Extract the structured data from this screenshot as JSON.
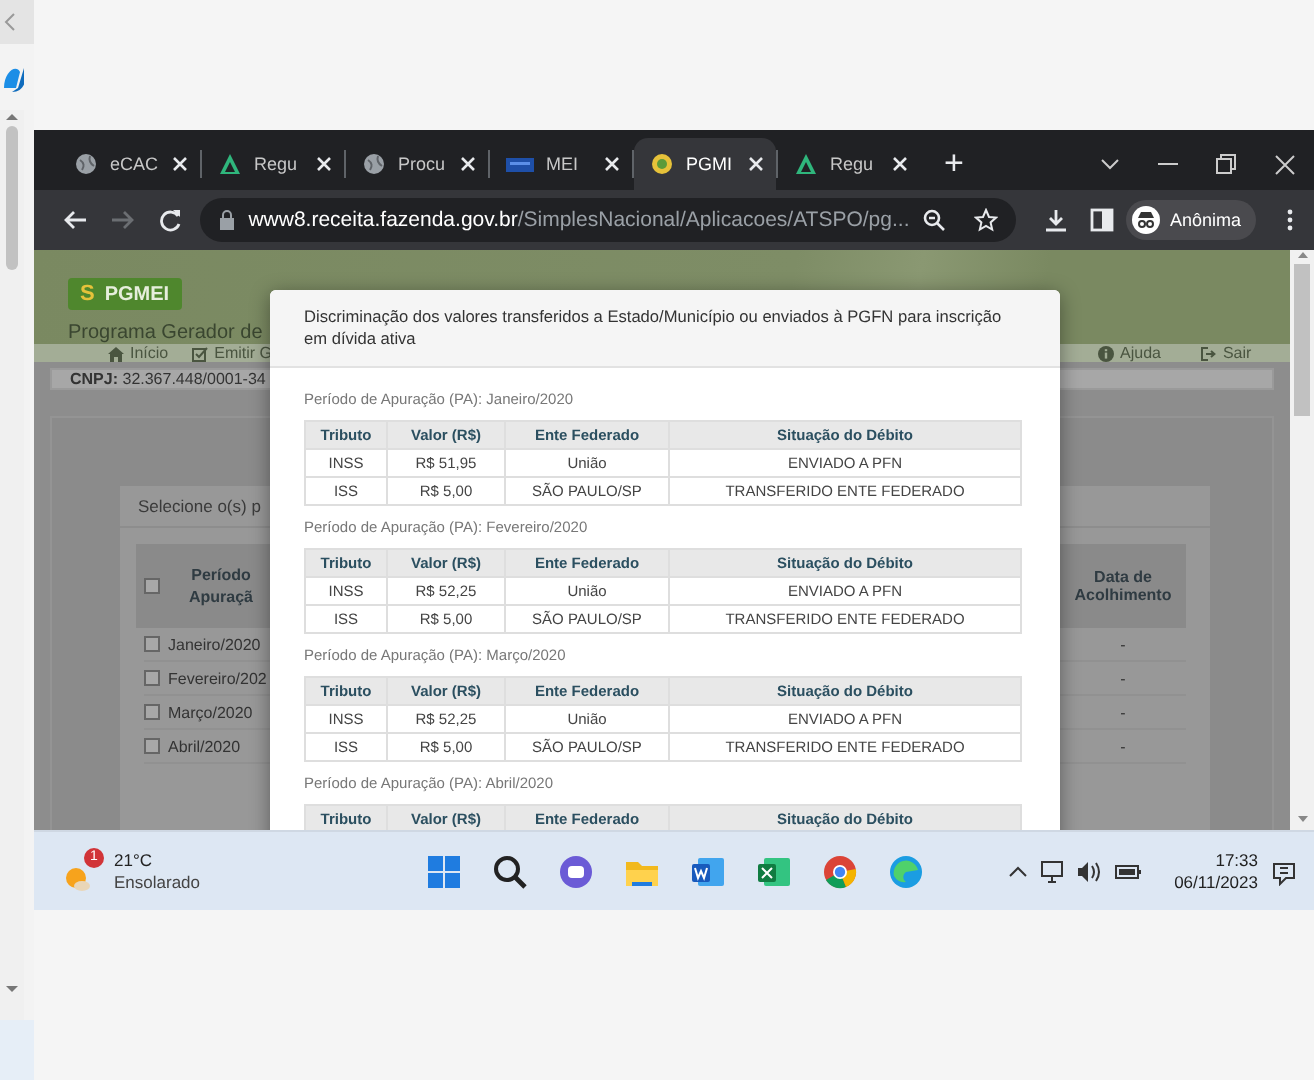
{
  "browser": {
    "tabs": [
      {
        "label": "eCAC",
        "kind": "globe",
        "selected": false
      },
      {
        "label": "Regu",
        "kind": "triangle",
        "selected": false
      },
      {
        "label": "Procu",
        "kind": "globe",
        "selected": false
      },
      {
        "label": "MEI",
        "kind": "mei",
        "selected": false
      },
      {
        "label": "PGMI",
        "kind": "coin",
        "selected": true
      },
      {
        "label": "Regu",
        "kind": "triangle",
        "selected": false
      }
    ],
    "new_tab": "+",
    "forward_disabled": true,
    "url": {
      "host": "www8.receita.fazenda.gov.br",
      "path": "/SimplesNacional/Aplicacoes/ATSPO/pg..."
    },
    "profile": "Anônima"
  },
  "page": {
    "logo_mark": "S",
    "logo": "PGMEI",
    "subtitle": "Programa Gerador de",
    "nav_left": [
      {
        "label": "Início",
        "kind": "home"
      },
      {
        "label": "Emitir G",
        "kind": "emit"
      }
    ],
    "nav_right": [
      {
        "label": "Ajuda",
        "kind": "help"
      },
      {
        "label": "Sair",
        "kind": "exit"
      }
    ],
    "cnpj_label": "CNPJ:",
    "cnpj": "32.367.448/0001-34",
    "card_title": "Selecione o(s) p",
    "columns": [
      "Período Apuraçã",
      "Data de Acolhimento"
    ],
    "all_checked": false,
    "rows": [
      {
        "period": "Janeiro/2020",
        "checked": false,
        "date": "-"
      },
      {
        "period": "Fevereiro/202",
        "checked": false,
        "date": "-"
      },
      {
        "period": "Março/2020",
        "checked": false,
        "date": "-"
      },
      {
        "period": "Abril/2020",
        "checked": false,
        "date": "-"
      }
    ]
  },
  "modal": {
    "title": "Discriminação dos valores transferidos a Estado/Município ou enviados à PGFN para inscrição em dívida ativa",
    "periods": [
      {
        "label": "Período de Apuração (PA): Janeiro/2020",
        "columns": [
          "Tributo",
          "Valor (R$)",
          "Ente Federado",
          "Situação do Débito"
        ],
        "rows": [
          [
            "INSS",
            "R$ 51,95",
            "União",
            "ENVIADO A PFN"
          ],
          [
            "ISS",
            "R$ 5,00",
            "SÃO PAULO/SP",
            "TRANSFERIDO ENTE FEDERADO"
          ]
        ]
      },
      {
        "label": "Período de Apuração (PA): Fevereiro/2020",
        "columns": [
          "Tributo",
          "Valor (R$)",
          "Ente Federado",
          "Situação do Débito"
        ],
        "rows": [
          [
            "INSS",
            "R$ 52,25",
            "União",
            "ENVIADO A PFN"
          ],
          [
            "ISS",
            "R$ 5,00",
            "SÃO PAULO/SP",
            "TRANSFERIDO ENTE FEDERADO"
          ]
        ]
      },
      {
        "label": "Período de Apuração (PA): Março/2020",
        "columns": [
          "Tributo",
          "Valor (R$)",
          "Ente Federado",
          "Situação do Débito"
        ],
        "rows": [
          [
            "INSS",
            "R$ 52,25",
            "União",
            "ENVIADO A PFN"
          ],
          [
            "ISS",
            "R$ 5,00",
            "SÃO PAULO/SP",
            "TRANSFERIDO ENTE FEDERADO"
          ]
        ]
      },
      {
        "label": "Período de Apuração (PA): Abril/2020",
        "columns": [
          "Tributo",
          "Valor (R$)",
          "Ente Federado",
          "Situação do Débito"
        ]
      }
    ]
  },
  "taskbar": {
    "badge": "1",
    "temperature": "21°C",
    "weather": "Ensolarado",
    "time": "17:33",
    "date": "06/11/2023"
  }
}
